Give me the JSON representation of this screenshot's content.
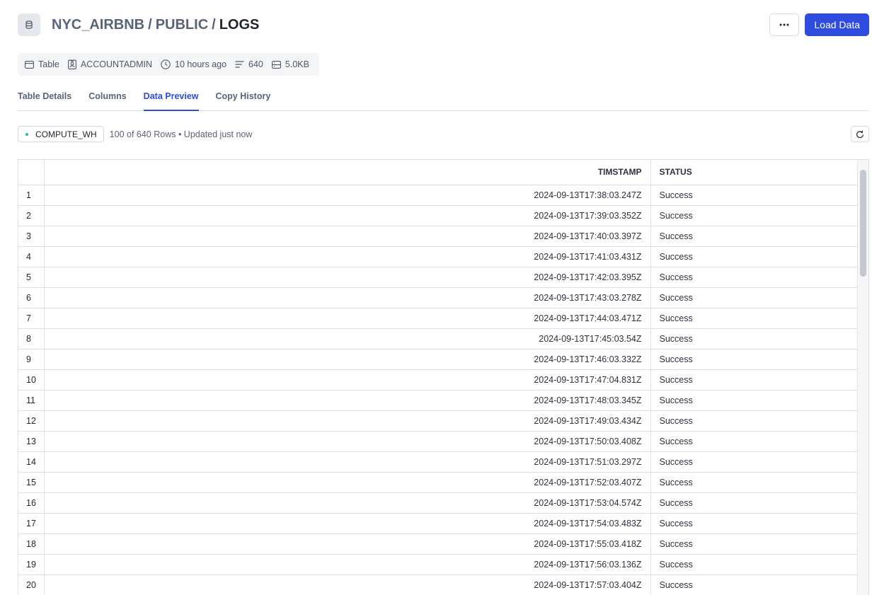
{
  "header": {
    "icon": "database-icon",
    "breadcrumb": [
      "NYC_AIRBNB",
      "PUBLIC",
      "LOGS"
    ],
    "separator": "/",
    "more_icon": "more-horizontal-icon",
    "load_button": "Load Data",
    "accent_color": "#2f4ce0"
  },
  "meta": {
    "type": "Table",
    "owner": "ACCOUNTADMIN",
    "updated": "10 hours ago",
    "rows": "640",
    "size": "5.0KB"
  },
  "tabs": [
    {
      "label": "Table Details",
      "active": false
    },
    {
      "label": "Columns",
      "active": false
    },
    {
      "label": "Data Preview",
      "active": true
    },
    {
      "label": "Copy History",
      "active": false
    }
  ],
  "toolbar": {
    "warehouse": "COMPUTE_WH",
    "rows_info": "100 of 640 Rows • Updated just now",
    "refresh_icon": "refresh-icon"
  },
  "table": {
    "columns": [
      "",
      "TIMSTAMP",
      "STATUS"
    ],
    "rows": [
      [
        "1",
        "2024-09-13T17:38:03.247Z",
        "Success"
      ],
      [
        "2",
        "2024-09-13T17:39:03.352Z",
        "Success"
      ],
      [
        "3",
        "2024-09-13T17:40:03.397Z",
        "Success"
      ],
      [
        "4",
        "2024-09-13T17:41:03.431Z",
        "Success"
      ],
      [
        "5",
        "2024-09-13T17:42:03.395Z",
        "Success"
      ],
      [
        "6",
        "2024-09-13T17:43:03.278Z",
        "Success"
      ],
      [
        "7",
        "2024-09-13T17:44:03.471Z",
        "Success"
      ],
      [
        "8",
        "2024-09-13T17:45:03.54Z",
        "Success"
      ],
      [
        "9",
        "2024-09-13T17:46:03.332Z",
        "Success"
      ],
      [
        "10",
        "2024-09-13T17:47:04.831Z",
        "Success"
      ],
      [
        "11",
        "2024-09-13T17:48:03.345Z",
        "Success"
      ],
      [
        "12",
        "2024-09-13T17:49:03.434Z",
        "Success"
      ],
      [
        "13",
        "2024-09-13T17:50:03.408Z",
        "Success"
      ],
      [
        "14",
        "2024-09-13T17:51:03.297Z",
        "Success"
      ],
      [
        "15",
        "2024-09-13T17:52:03.407Z",
        "Success"
      ],
      [
        "16",
        "2024-09-13T17:53:04.574Z",
        "Success"
      ],
      [
        "17",
        "2024-09-13T17:54:03.483Z",
        "Success"
      ],
      [
        "18",
        "2024-09-13T17:55:03.418Z",
        "Success"
      ],
      [
        "19",
        "2024-09-13T17:56:03.136Z",
        "Success"
      ],
      [
        "20",
        "2024-09-13T17:57:03.404Z",
        "Success"
      ]
    ]
  }
}
